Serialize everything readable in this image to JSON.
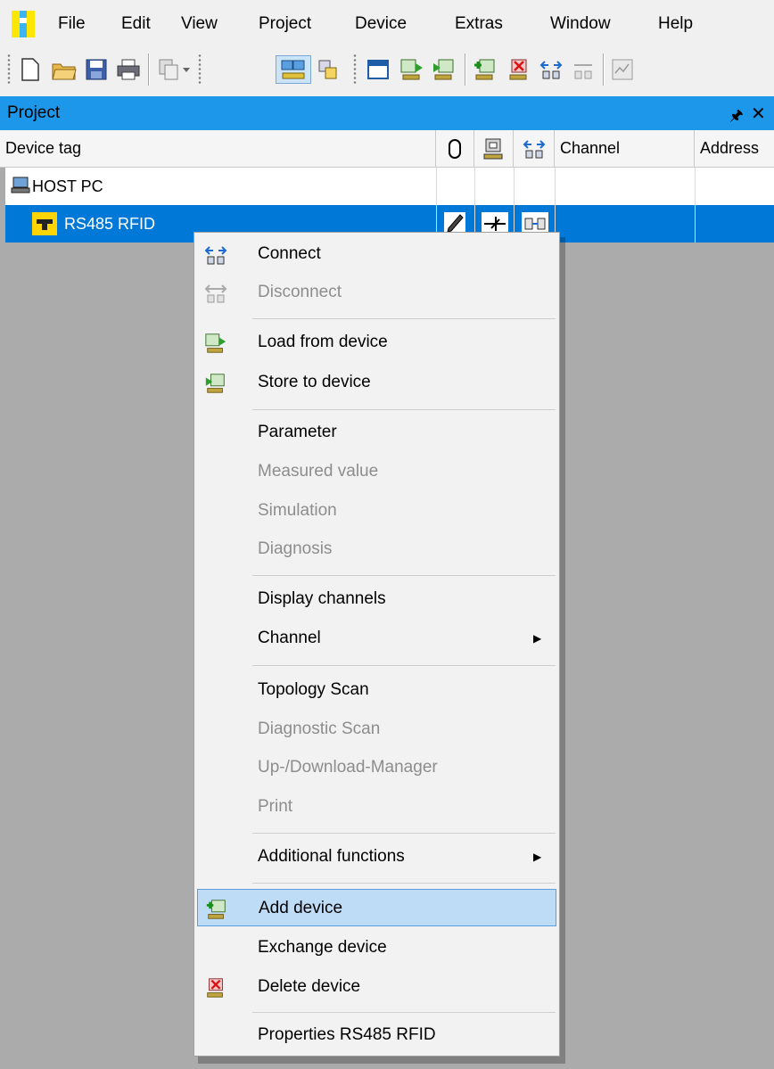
{
  "colors": {
    "panel_header": "#1c97ea",
    "selection": "#0078d7",
    "menu_highlight": "#bfdcf6",
    "background": "#ababab"
  },
  "menubar": {
    "logo_icon": "app-logo-icon",
    "items": [
      "File",
      "Edit",
      "View",
      "Project",
      "Device",
      "Extras",
      "Window",
      "Help"
    ]
  },
  "toolbar": {
    "icons": [
      "new-document-icon",
      "open-folder-icon",
      "save-icon",
      "print-icon",
      "copy-device-icon",
      "project-view-icon",
      "catalog-icon",
      "window-icon",
      "load-from-device-icon",
      "store-to-device-icon",
      "add-device-icon",
      "delete-device-icon",
      "connect-icon",
      "disconnect-icon",
      "measured-value-icon"
    ]
  },
  "panel": {
    "title": "Project",
    "pin_icon": "pin-icon",
    "close_icon": "close-icon"
  },
  "columns": {
    "device_tag": "Device tag",
    "channel": "Channel",
    "address": "Address"
  },
  "tree": {
    "host": {
      "label": "HOST PC",
      "icon": "computer-icon"
    },
    "device": {
      "label": "RS485 RFID",
      "icon": "rfid-device-icon"
    }
  },
  "context_menu": {
    "connect": "Connect",
    "disconnect": "Disconnect",
    "load_from_device": "Load from device",
    "store_to_device": "Store to device",
    "parameter": "Parameter",
    "measured_value": "Measured value",
    "simulation": "Simulation",
    "diagnosis": "Diagnosis",
    "display_channels": "Display channels",
    "channel": "Channel",
    "topology_scan": "Topology Scan",
    "diagnostic_scan": "Diagnostic Scan",
    "updownload_manager": "Up-/Download-Manager",
    "print": "Print",
    "additional_functions": "Additional functions",
    "add_device": "Add device",
    "exchange_device": "Exchange device",
    "delete_device": "Delete device",
    "properties": "Properties RS485 RFID"
  }
}
